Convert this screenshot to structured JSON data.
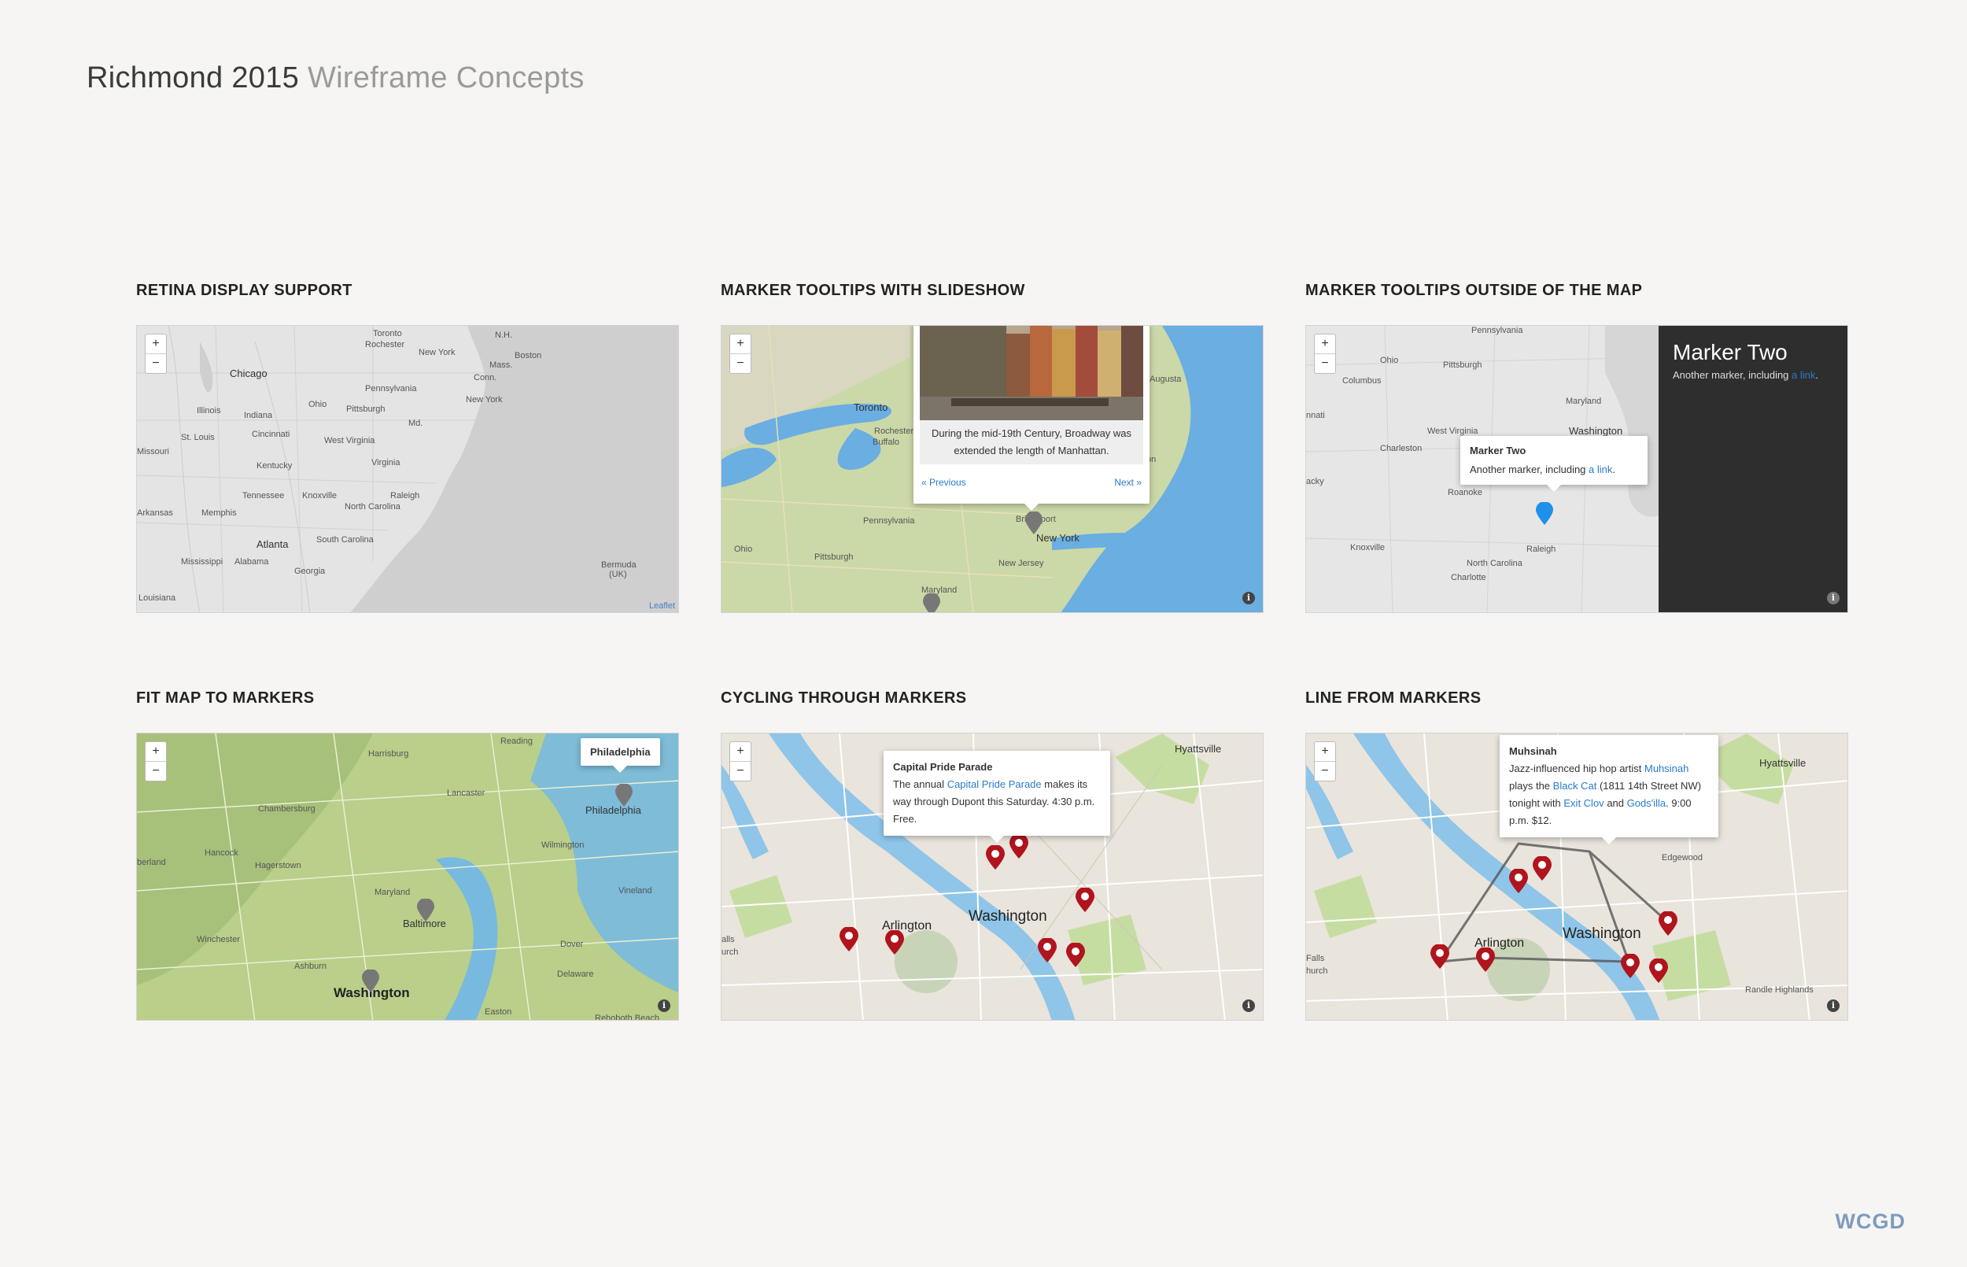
{
  "header": {
    "title_main": "Richmond 2015",
    "title_sub": "Wireframe Concepts"
  },
  "brand": "WCGD",
  "zoom": {
    "plus": "+",
    "minus": "−"
  },
  "info_icon": "i",
  "panels": {
    "retina": {
      "label": "RETINA DISPLAY SUPPORT",
      "attribution": "Leaflet",
      "labels": {
        "toronto": "Toronto",
        "rochester": "Rochester",
        "nh": "N.H.",
        "boston": "Boston",
        "newyork_state": "New York",
        "mass": "Mass.",
        "conn": "Conn.",
        "chicago": "Chicago",
        "pennsylvania": "Pennsylvania",
        "newyork": "New York",
        "ohio": "Ohio",
        "illinois": "Illinois",
        "indiana": "Indiana",
        "pittsburgh": "Pittsburgh",
        "md": "Md.",
        "stlouis": "St. Louis",
        "cincinnati": "Cincinnati",
        "westvirginia": "West Virginia",
        "missouri": "Missouri",
        "kentucky": "Kentucky",
        "virginia": "Virginia",
        "raleigh": "Raleigh",
        "tennessee": "Tennessee",
        "knoxville": "Knoxville",
        "northcarolina": "North Carolina",
        "arkansas": "Arkansas",
        "memphis": "Memphis",
        "atlanta": "Atlanta",
        "southcarolina": "South Carolina",
        "mississippi": "Mississippi",
        "alabama": "Alabama",
        "georgia": "Georgia",
        "louisiana": "Louisiana",
        "bermuda": "Bermuda",
        "uk": "(UK)"
      }
    },
    "slideshow": {
      "label": "MARKER TOOLTIPS WITH SLIDESHOW",
      "popup_text": "During the mid-19th Century, Broadway was extended the length of Manhattan.",
      "prev": "« Previous",
      "next": "Next »",
      "labels": {
        "toronto": "Toronto",
        "rochester": "Rochester",
        "buffalo": "Buffalo",
        "ohio": "Ohio",
        "pennsylvania": "Pennsylvania",
        "pittsburgh": "Pittsburgh",
        "newyork": "New York",
        "newjersey": "New Jersey",
        "bridgeport": "Bridgeport",
        "maryland": "Maryland",
        "augusta": "Augusta",
        "on": "on"
      }
    },
    "outside": {
      "label": "MARKER TOOLTIPS OUTSIDE OF THE MAP",
      "panel_title": "Marker Two",
      "panel_text": "Another marker, including",
      "panel_link": "a link",
      "panel_end": ".",
      "popup_title": "Marker Two",
      "popup_text": "Another marker, including",
      "popup_link": "a link",
      "popup_end": ".",
      "labels": {
        "pennsylvania": "Pennsylvania",
        "ohio": "Ohio",
        "pittsburgh": "Pittsburgh",
        "columbus": "Columbus",
        "maryland": "Maryland",
        "washington": "Washington",
        "westvirginia": "West Virginia",
        "charleston": "Charleston",
        "nnati": "nnati",
        "roanoke": "Roanoke",
        "acky": "acky",
        "knoxville": "Knoxville",
        "raleigh": "Raleigh",
        "northcarolina": "North Carolina",
        "charlotte": "Charlotte"
      }
    },
    "fit": {
      "label": "FIT MAP TO MARKERS",
      "popup_title": "Philadelphia",
      "labels": {
        "harrisburg": "Harrisburg",
        "reading": "Reading",
        "lancaster": "Lancaster",
        "chambersburg": "Chambersburg",
        "philadelphia": "Philadelphia",
        "wilmington": "Wilmington",
        "hancock": "Hancock",
        "berland": "berland",
        "hagerstown": "Hagerstown",
        "vineland": "Vineland",
        "maryland": "Maryland",
        "baltimore": "Baltimore",
        "winchester": "Winchester",
        "dover": "Dover",
        "ashburn": "Ashburn",
        "delaware": "Delaware",
        "washington": "Washington",
        "easton": "Easton",
        "rehoboth": "Rehoboth Beach"
      }
    },
    "cycling": {
      "label": "CYCLING THROUGH MARKERS",
      "popup_title": "Capital Pride Parade",
      "popup_pre": "The annual",
      "popup_link": "Capital Pride Parade",
      "popup_post": "makes its way through Dupont this Saturday. 4:30 p.m. Free.",
      "labels": {
        "hyattsville": "Hyattsville",
        "washington": "Washington",
        "arlington": "Arlington",
        "alls": "alls",
        "urch": "urch"
      }
    },
    "line": {
      "label": "LINE FROM MARKERS",
      "popup_title": "Muhsinah",
      "popup_pre": "Jazz-influenced hip hop artist",
      "popup_link1": "Muhsinah",
      "popup_mid1": "plays the",
      "popup_link2": "Black Cat",
      "popup_mid2": "(1811 14th Street NW) tonight with",
      "popup_link3": "Exit Clov",
      "popup_and": "and",
      "popup_link4": "Gods'illa",
      "popup_post": ". 9:00 p.m. $12.",
      "labels": {
        "hyattsville": "Hyattsville",
        "edgewood": "Edgewood",
        "washington": "Washington",
        "arlington": "Arlington",
        "falls": "Falls",
        "hurch": "hurch",
        "randle": "Randle Highlands"
      }
    }
  },
  "colors": {
    "background": "#f6f5f3",
    "link": "#2a7ac9",
    "marker_red": "#b0141d",
    "marker_gray": "#7a7a7a",
    "marker_blue": "#1e90e8",
    "dark_panel": "#2e2e2e",
    "water": "#8ec5e8",
    "brand": "#7e9bbd"
  }
}
